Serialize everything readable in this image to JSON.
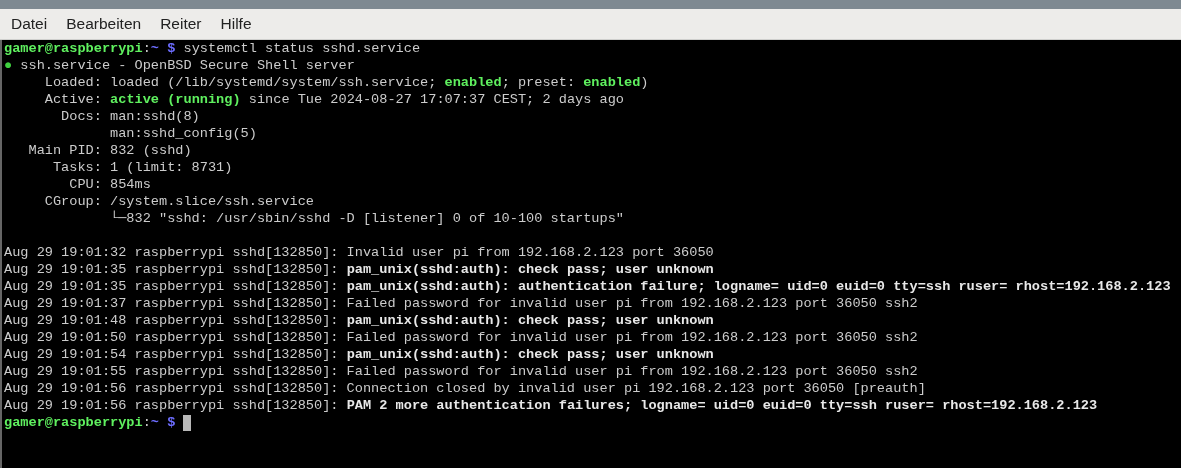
{
  "menu_bar": [
    {
      "label": "Datei"
    },
    {
      "label": "Bearbeiten"
    },
    {
      "label": "Reiter"
    },
    {
      "label": "Hilfe"
    }
  ],
  "terminal": {
    "status_lines": [
      [
        {
          "kind": "user",
          "text": "gamer@raspberrypi"
        },
        {
          "kind": "plain",
          "text": ":"
        },
        {
          "kind": "path",
          "text": "~ $"
        },
        {
          "kind": "plain",
          "text": " systemctl status sshd.service"
        }
      ],
      [
        {
          "kind": "dot",
          "text": "●"
        },
        {
          "kind": "plain",
          "text": " ssh.service - OpenBSD Secure Shell server"
        }
      ],
      [
        {
          "kind": "plain",
          "text": "     Loaded: loaded (/lib/systemd/system/ssh.service; "
        },
        {
          "kind": "ok",
          "text": "enabled"
        },
        {
          "kind": "plain",
          "text": "; preset: "
        },
        {
          "kind": "ok",
          "text": "enabled"
        },
        {
          "kind": "plain",
          "text": ")"
        }
      ],
      [
        {
          "kind": "plain",
          "text": "     Active: "
        },
        {
          "kind": "ok",
          "text": "active (running)"
        },
        {
          "kind": "plain",
          "text": " since Tue 2024-08-27 17:07:37 CEST; 2 days ago"
        }
      ],
      [
        {
          "kind": "plain",
          "text": "       Docs: man:sshd(8)"
        }
      ],
      [
        {
          "kind": "plain",
          "text": "             man:sshd_config(5)"
        }
      ],
      [
        {
          "kind": "plain",
          "text": "   Main PID: 832 (sshd)"
        }
      ],
      [
        {
          "kind": "plain",
          "text": "      Tasks: 1 (limit: 8731)"
        }
      ],
      [
        {
          "kind": "plain",
          "text": "        CPU: 854ms"
        }
      ],
      [
        {
          "kind": "plain",
          "text": "     CGroup: /system.slice/ssh.service"
        }
      ],
      [
        {
          "kind": "plain",
          "text": "             └─832 \"sshd: /usr/sbin/sshd -D [listener] 0 of 10-100 startups\""
        }
      ]
    ],
    "journal_lines": [
      [
        {
          "kind": "plain",
          "text": "Aug 29 19:01:32 raspberrypi sshd[132850]: Invalid user pi from 192.168.2.123 port 36050"
        }
      ],
      [
        {
          "kind": "plain",
          "text": "Aug 29 19:01:35 raspberrypi sshd[132850]: "
        },
        {
          "kind": "bold",
          "text": "pam_unix(sshd:auth): check pass; user unknown"
        }
      ],
      [
        {
          "kind": "plain",
          "text": "Aug 29 19:01:35 raspberrypi sshd[132850]: "
        },
        {
          "kind": "bold",
          "text": "pam_unix(sshd:auth): authentication failure; logname= uid=0 euid=0 tty=ssh ruser= rhost=192.168.2.123"
        }
      ],
      [
        {
          "kind": "plain",
          "text": "Aug 29 19:01:37 raspberrypi sshd[132850]: Failed password for invalid user pi from 192.168.2.123 port 36050 ssh2"
        }
      ],
      [
        {
          "kind": "plain",
          "text": "Aug 29 19:01:48 raspberrypi sshd[132850]: "
        },
        {
          "kind": "bold",
          "text": "pam_unix(sshd:auth): check pass; user unknown"
        }
      ],
      [
        {
          "kind": "plain",
          "text": "Aug 29 19:01:50 raspberrypi sshd[132850]: Failed password for invalid user pi from 192.168.2.123 port 36050 ssh2"
        }
      ],
      [
        {
          "kind": "plain",
          "text": "Aug 29 19:01:54 raspberrypi sshd[132850]: "
        },
        {
          "kind": "bold",
          "text": "pam_unix(sshd:auth): check pass; user unknown"
        }
      ],
      [
        {
          "kind": "plain",
          "text": "Aug 29 19:01:55 raspberrypi sshd[132850]: Failed password for invalid user pi from 192.168.2.123 port 36050 ssh2"
        }
      ],
      [
        {
          "kind": "plain",
          "text": "Aug 29 19:01:56 raspberrypi sshd[132850]: Connection closed by invalid user pi 192.168.2.123 port 36050 [preauth]"
        }
      ],
      [
        {
          "kind": "plain",
          "text": "Aug 29 19:01:56 raspberrypi sshd[132850]: "
        },
        {
          "kind": "bold",
          "text": "PAM 2 more authentication failures; logname= uid=0 euid=0 tty=ssh ruser= rhost=192.168.2.123"
        }
      ]
    ],
    "prompt": [
      {
        "kind": "user",
        "text": "gamer@raspberrypi"
      },
      {
        "kind": "plain",
        "text": ":"
      },
      {
        "kind": "path",
        "text": "~ $"
      }
    ]
  }
}
